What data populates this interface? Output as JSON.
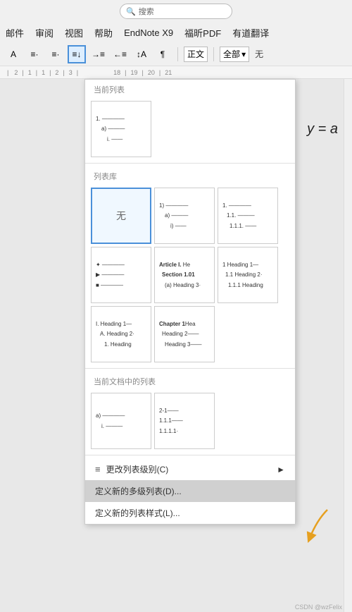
{
  "titleBar": {
    "searchPlaceholder": "搜索"
  },
  "menuBar": {
    "items": [
      "邮件",
      "审阅",
      "视图",
      "帮助",
      "EndNote X9",
      "福昕PDF",
      "有道翻译"
    ]
  },
  "toolbar": {
    "buttons": [
      "A",
      "≡",
      "≡",
      "≡",
      "≡",
      "≡",
      "→",
      "←→",
      "↕",
      "↑↓",
      "⇅"
    ],
    "styleLabel": "正文",
    "styleDropdown": "全部",
    "noWrap": "无"
  },
  "dropdown": {
    "currentList": {
      "label": "当前列表",
      "items": [
        {
          "type": "numbered",
          "lines": [
            "1.",
            "a)",
            "i."
          ]
        }
      ]
    },
    "listLibrary": {
      "label": "列表库",
      "items": [
        {
          "type": "none",
          "label": "无"
        },
        {
          "type": "alpha",
          "lines": [
            "1)",
            "a)",
            "i)"
          ]
        },
        {
          "type": "dotted",
          "lines": [
            "1.",
            "1.1.",
            "1.1.1."
          ]
        },
        {
          "type": "symbol",
          "lines": [
            "✦ ——",
            "▶ ——",
            "■ ——"
          ]
        },
        {
          "type": "article",
          "lines": [
            "Article I. He",
            "Section 1.01",
            "(a) Heading 3·"
          ]
        },
        {
          "type": "heading1",
          "lines": [
            "1 Heading 1—",
            "1.1 Heading 2·",
            "1.1.1 Heading"
          ]
        },
        {
          "type": "roman",
          "lines": [
            "I. Heading 1—",
            "A. Heading 2·",
            "1. Heading"
          ]
        },
        {
          "type": "chapter",
          "lines": [
            "Chapter 1 Hea",
            "Heading 2——",
            "Heading 3——"
          ]
        }
      ]
    },
    "currentDoc": {
      "label": "当前文档中的列表",
      "items": [
        {
          "type": "alpha2",
          "lines": [
            "a)",
            "i."
          ]
        },
        {
          "type": "numbered2",
          "lines": [
            "2-1——",
            "1.1.1——",
            "1.1.1.1·"
          ]
        }
      ]
    },
    "actions": [
      {
        "icon": "≡",
        "label": "更改列表级别(C)",
        "arrow": "►"
      },
      {
        "icon": "",
        "label": "定义新的多级列表(D)...",
        "highlight": true
      },
      {
        "icon": "",
        "label": "定义新的列表样式(L)..."
      }
    ]
  },
  "mathEq": "y = a",
  "watermark": "CSDN @wzFelix"
}
